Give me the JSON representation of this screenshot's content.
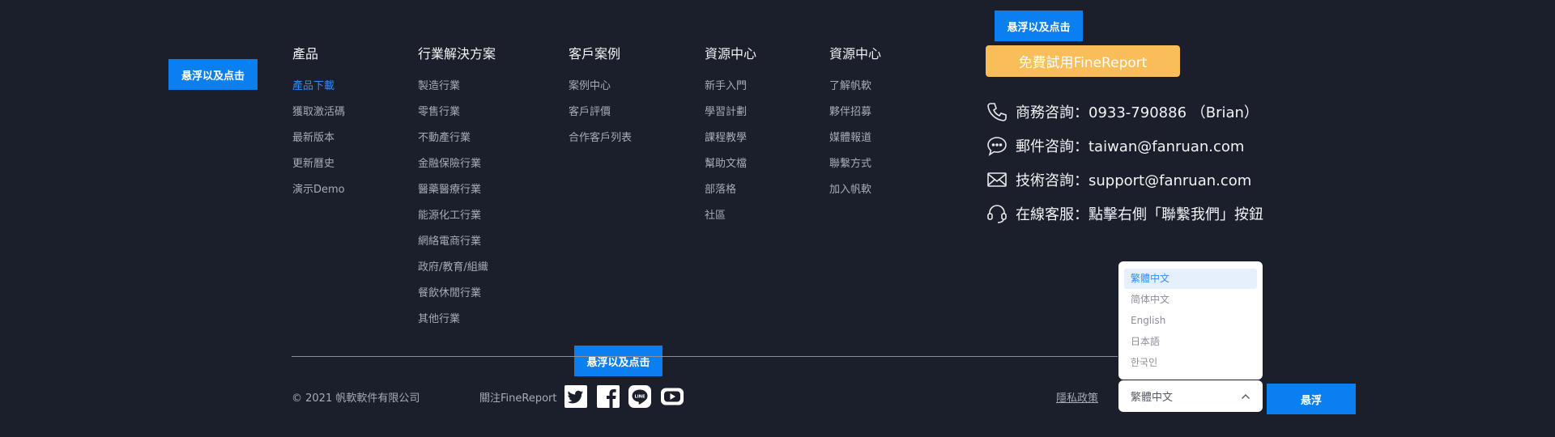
{
  "hover_buttons": {
    "left": "悬浮以及点击",
    "top": "悬浮以及点击",
    "bottom": "悬浮以及点击",
    "right": "悬浮"
  },
  "columns": [
    {
      "title": "產品",
      "links": [
        "產品下載",
        "獲取激活碼",
        "最新版本",
        "更新曆史",
        "演示Demo"
      ]
    },
    {
      "title": "行業解決方案",
      "links": [
        "製造行業",
        "零售行業",
        "不動產行業",
        "金融保險行業",
        "醫藥醫療行業",
        "能源化工行業",
        "網絡電商行業",
        "政府/教育/組織",
        "餐飲休閒行業",
        "其他行業"
      ]
    },
    {
      "title": "客戶案例",
      "links": [
        "案例中心",
        "客戶評價",
        "合作客戶列表"
      ]
    },
    {
      "title": "資源中心",
      "links": [
        "新手入門",
        "學習計劃",
        "課程教學",
        "幫助文檔",
        "部落格",
        "社區"
      ]
    },
    {
      "title": "資源中心",
      "links": [
        "了解帆軟",
        "夥伴招募",
        "媒體報道",
        "聯繫方式",
        "加入帆軟"
      ]
    }
  ],
  "trial_button": "免費試用FineReport",
  "contacts": [
    {
      "icon": "phone-icon",
      "text": "商務咨詢：0933-790886 （Brian）"
    },
    {
      "icon": "chat-bubble-icon",
      "text": "郵件咨詢：taiwan@fanruan.com"
    },
    {
      "icon": "mail-icon",
      "text": "技術咨詢：support@fanruan.com"
    },
    {
      "icon": "headset-icon",
      "text": "在線客服：點擊右側「聯繫我們」按鈕"
    }
  ],
  "footer": {
    "copyright": "© 2021 帆軟軟件有限公司",
    "follow": "關注FineReport",
    "social": [
      "twitter-icon",
      "facebook-icon",
      "line-icon",
      "youtube-icon"
    ],
    "privacy": "隱私政策"
  },
  "language": {
    "selected": "繁體中文",
    "options": [
      "繁體中文",
      "简体中文",
      "English",
      "日本語",
      "한국인"
    ]
  },
  "colors": {
    "background": "#1b1f2b",
    "accent_blue": "#0a7ff0",
    "link_active": "#2f8cff",
    "trial_yellow": "#f9be5a"
  }
}
